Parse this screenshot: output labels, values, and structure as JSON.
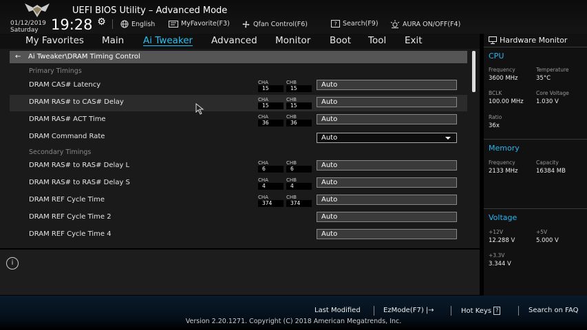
{
  "header": {
    "title": "UEFI BIOS Utility – Advanced Mode",
    "date": "01/12/2019",
    "day": "Saturday",
    "time": "19:28",
    "language": "English",
    "myfavorite": "MyFavorite(F3)",
    "qfan": "Qfan Control(F6)",
    "search": "Search(F9)",
    "aura": "AURA ON/OFF(F4)"
  },
  "menu": [
    "My Favorites",
    "Main",
    "Ai Tweaker",
    "Advanced",
    "Monitor",
    "Boot",
    "Tool",
    "Exit"
  ],
  "active_menu": "Ai Tweaker",
  "breadcrumb": "Ai Tweaker\\DRAM Timing Control",
  "sections": {
    "primary": "Primary Timings",
    "secondary": "Secondary Timings"
  },
  "channel_labels": {
    "a": "CHA",
    "b": "CHB"
  },
  "rows": [
    {
      "label": "DRAM CAS# Latency",
      "cha": "15",
      "chb": "15",
      "value": "Auto"
    },
    {
      "label": "DRAM RAS# to CAS# Delay",
      "cha": "15",
      "chb": "15",
      "value": "Auto"
    },
    {
      "label": "DRAM RAS# ACT Time",
      "cha": "36",
      "chb": "36",
      "value": "Auto"
    },
    {
      "label": "DRAM Command Rate",
      "value": "Auto"
    },
    {
      "label": "DRAM RAS# to RAS# Delay L",
      "cha": "6",
      "chb": "6",
      "value": "Auto"
    },
    {
      "label": "DRAM RAS# to RAS# Delay S",
      "cha": "4",
      "chb": "4",
      "value": "Auto"
    },
    {
      "label": "DRAM REF Cycle Time",
      "cha": "374",
      "chb": "374",
      "value": "Auto"
    },
    {
      "label": "DRAM REF Cycle Time 2",
      "value": "Auto"
    },
    {
      "label": "DRAM REF Cycle Time 4",
      "value": "Auto"
    }
  ],
  "hardware_monitor": {
    "title": "Hardware Monitor",
    "cpu": {
      "title": "CPU",
      "frequency_label": "Frequency",
      "frequency": "3600 MHz",
      "temperature_label": "Temperature",
      "temperature": "35°C",
      "bclk_label": "BCLK",
      "bclk": "100.00 MHz",
      "core_voltage_label": "Core Voltage",
      "core_voltage": "1.030 V",
      "ratio_label": "Ratio",
      "ratio": "36x"
    },
    "memory": {
      "title": "Memory",
      "frequency_label": "Frequency",
      "frequency": "2133 MHz",
      "capacity_label": "Capacity",
      "capacity": "16384 MB"
    },
    "voltage": {
      "title": "Voltage",
      "v12_label": "+12V",
      "v12": "12.288 V",
      "v5_label": "+5V",
      "v5": "5.000 V",
      "v33_label": "+3.3V",
      "v33": "3.344 V"
    }
  },
  "footer": {
    "last_modified": "Last Modified",
    "ezmode": "EzMode(F7)",
    "hotkeys": "Hot Keys",
    "hotkeys_key": "?",
    "search_faq": "Search on FAQ",
    "version": "Version 2.20.1271. Copyright (C) 2018 American Megatrends, Inc."
  },
  "colors": {
    "accent": "#29c0f0",
    "background": "#1a1a1a"
  }
}
